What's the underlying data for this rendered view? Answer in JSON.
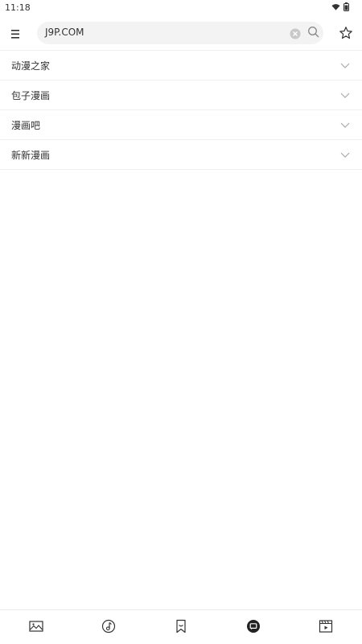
{
  "status": {
    "time": "11:18",
    "icons": [
      "wifi-icon",
      "battery-icon"
    ]
  },
  "search": {
    "value": "J9P.COM"
  },
  "list": {
    "items": [
      {
        "label": "动漫之家"
      },
      {
        "label": "包子漫画"
      },
      {
        "label": "漫画吧"
      },
      {
        "label": "新新漫画"
      }
    ]
  },
  "bottom_nav": {
    "items": [
      "image-icon",
      "music-icon",
      "bookmark-icon",
      "chat-icon",
      "video-icon"
    ]
  },
  "colors": {
    "icon": "#333333",
    "divider": "#f0f0f0",
    "search_bg": "#f3f3f3"
  }
}
